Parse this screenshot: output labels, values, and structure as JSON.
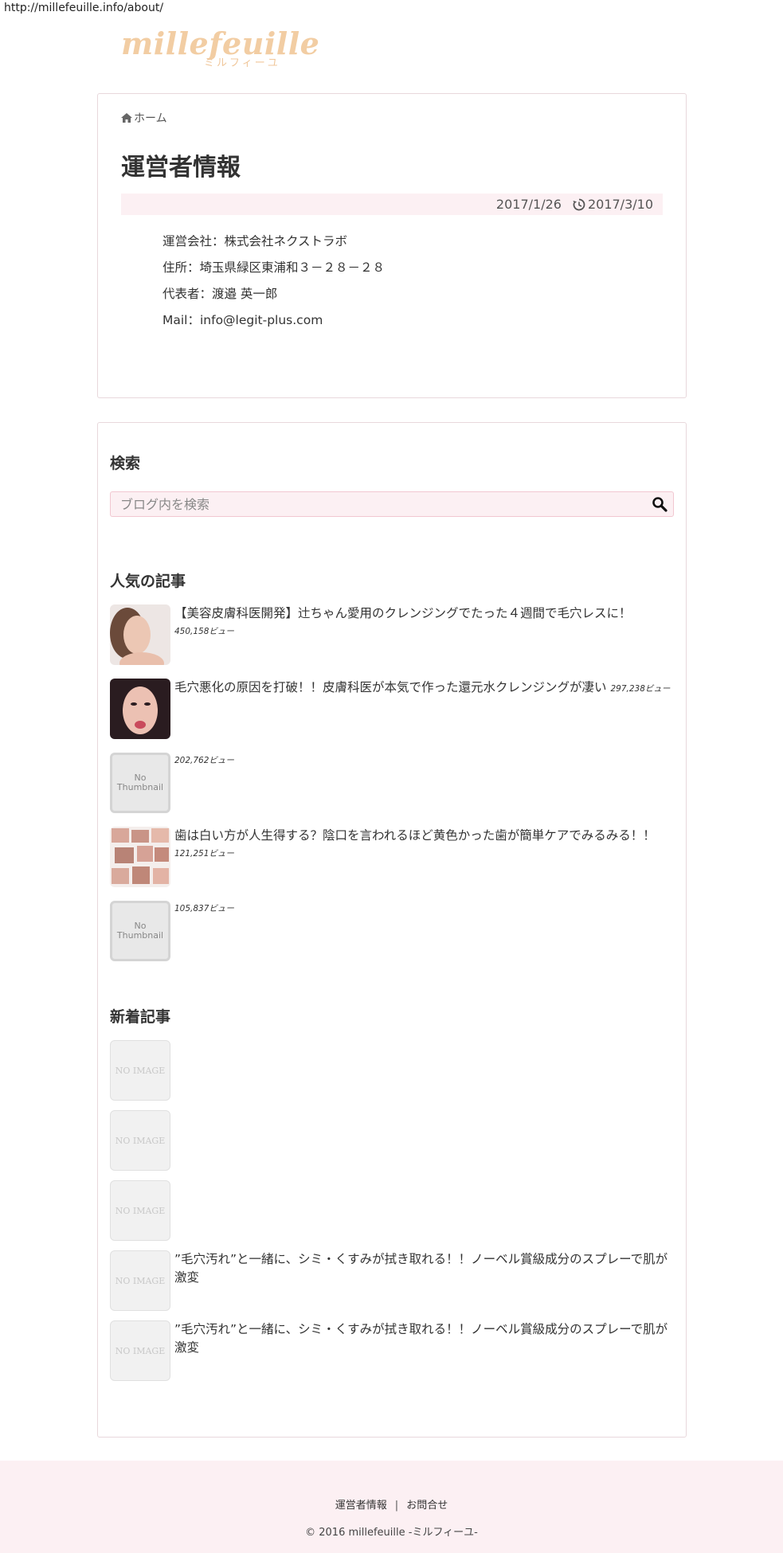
{
  "url": "http://millefeuille.info/about/",
  "logo": {
    "main": "millefeuille",
    "sub": "ミルフィーユ"
  },
  "breadcrumb": {
    "home_label": "ホーム"
  },
  "article": {
    "title": "運営者情報",
    "published": "2017/1/26",
    "updated": "2017/3/10",
    "info": [
      "運営会社：株式会社ネクストラボ",
      "住所：埼玉県緑区東浦和３－２８－２８",
      "代表者：渡邉 英一郎",
      "Mail：info@legit-plus.com"
    ]
  },
  "sidebar": {
    "search_heading": "検索",
    "search_placeholder": "ブログ内を検索",
    "popular_heading": "人気の記事",
    "popular": [
      {
        "title": "【美容皮膚科医開発】辻ちゃん愛用のクレンジングでたった４週間で毛穴レスに！",
        "views": "450,158ビュー"
      },
      {
        "title": "毛穴悪化の原因を打破！！皮膚科医が本気で作った還元水クレンジングが凄い",
        "views": "297,238ビュー"
      },
      {
        "title": "",
        "views": "202,762ビュー"
      },
      {
        "title": "歯は白い方が人生得する？陰口を言われるほど黄色かった歯が簡単ケアでみるみる！！",
        "views": "121,251ビュー"
      },
      {
        "title": "",
        "views": "105,837ビュー"
      }
    ],
    "no_thumbnail": {
      "line1": "No",
      "line2": "Thumbnail"
    },
    "new_heading": "新着記事",
    "no_image": "NO IMAGE",
    "new_posts": [
      {
        "title": ""
      },
      {
        "title": ""
      },
      {
        "title": ""
      },
      {
        "title": "”毛穴汚れ”と一緒に、シミ・くすみが拭き取れる！！ノーベル賞級成分のスプレーで肌が激変"
      },
      {
        "title": "”毛穴汚れ”と一緒に、シミ・くすみが拭き取れる！！ノーベル賞級成分のスプレーで肌が激変"
      }
    ]
  },
  "footer": {
    "link1": "運営者情報",
    "separator": "|",
    "link2": "お問合せ",
    "copyright": "© 2016 millefeuille -ミルフィーユ-"
  },
  "colors": {
    "accent_pink": "#fcf0f3",
    "logo_gold": "#f2cda3",
    "border": "#e8d8dc"
  }
}
